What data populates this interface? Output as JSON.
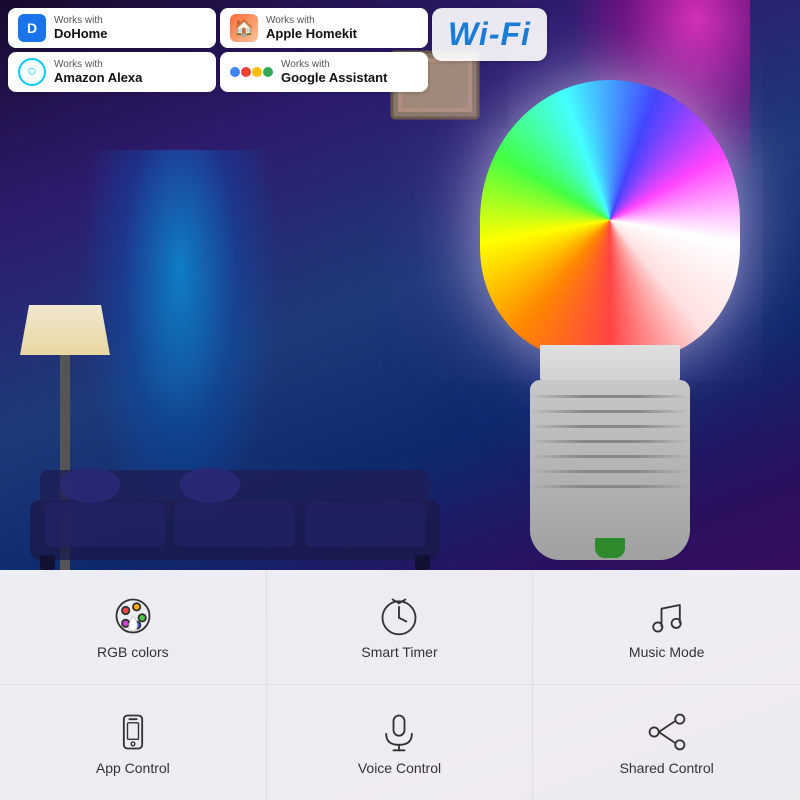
{
  "background": {
    "color_start": "#1a0a2e",
    "color_end": "#3d0d5a"
  },
  "wifi_badge": {
    "text": "Wi Fi",
    "display": "Wi-Fi"
  },
  "badges": [
    {
      "id": "dohome",
      "works_with": "Works with",
      "name": "DoHome",
      "icon_label": "dohome-icon"
    },
    {
      "id": "homekit",
      "works_with": "Works with",
      "name": "Apple Homekit",
      "icon_label": "homekit-icon"
    },
    {
      "id": "alexa",
      "works_with": "Works with",
      "name": "Amazon Alexa",
      "icon_label": "alexa-icon"
    },
    {
      "id": "google",
      "works_with": "Works with",
      "name": "Google Assistant",
      "icon_label": "google-icon"
    }
  ],
  "features": [
    {
      "id": "rgb-colors",
      "label": "RGB colors",
      "icon": "palette"
    },
    {
      "id": "smart-timer",
      "label": "Smart Timer",
      "icon": "clock"
    },
    {
      "id": "music-mode",
      "label": "Music Mode",
      "icon": "music"
    },
    {
      "id": "app-control",
      "label": "App Control",
      "icon": "phone"
    },
    {
      "id": "voice-control",
      "label": "Voice Control",
      "icon": "mic"
    },
    {
      "id": "shared-control",
      "label": "Shared Control",
      "icon": "share"
    }
  ]
}
